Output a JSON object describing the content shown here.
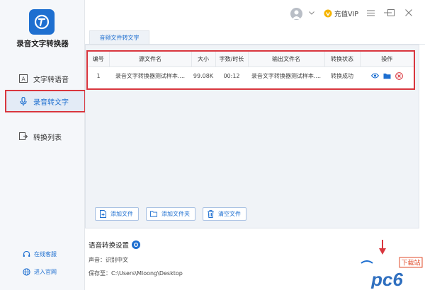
{
  "app": {
    "name": "录音文字转换器"
  },
  "sidebar": {
    "items": [
      {
        "label": "文字转语音",
        "icon": "text-icon"
      },
      {
        "label": "录音转文字",
        "icon": "microphone-icon"
      },
      {
        "label": "转换列表",
        "icon": "list-convert-icon"
      }
    ],
    "footer": {
      "service_label": "在线客服",
      "website_label": "进入官网"
    }
  },
  "topbar": {
    "vip_label": "充值VIP"
  },
  "tab": {
    "label": "音频文件转文字"
  },
  "table": {
    "headers": [
      "编号",
      "源文件名",
      "大小",
      "字数/时长",
      "输出文件名",
      "转换状态",
      "操作"
    ],
    "rows": [
      {
        "index": "1",
        "source_name": "录音文字转换器测试样本....",
        "size": "99.08K",
        "duration": "00:12",
        "output_name": "录音文字转换器测试样本....",
        "status": "转换成功"
      }
    ]
  },
  "buttons": {
    "add_file": "添加文件",
    "add_folder": "添加文件夹",
    "clear_files": "清空文件"
  },
  "settings": {
    "title": "语音转换设置",
    "voice_label": "声音：",
    "voice_value": "识别中文",
    "save_label": "保存至：",
    "save_path": "C:\\Users\\Mloong\\Desktop"
  },
  "watermark": {
    "site": "pc6",
    "tag": "下载站"
  },
  "colors": {
    "accent": "#1e6fd0",
    "highlight": "#d9363e",
    "vip": "#f5b400"
  }
}
